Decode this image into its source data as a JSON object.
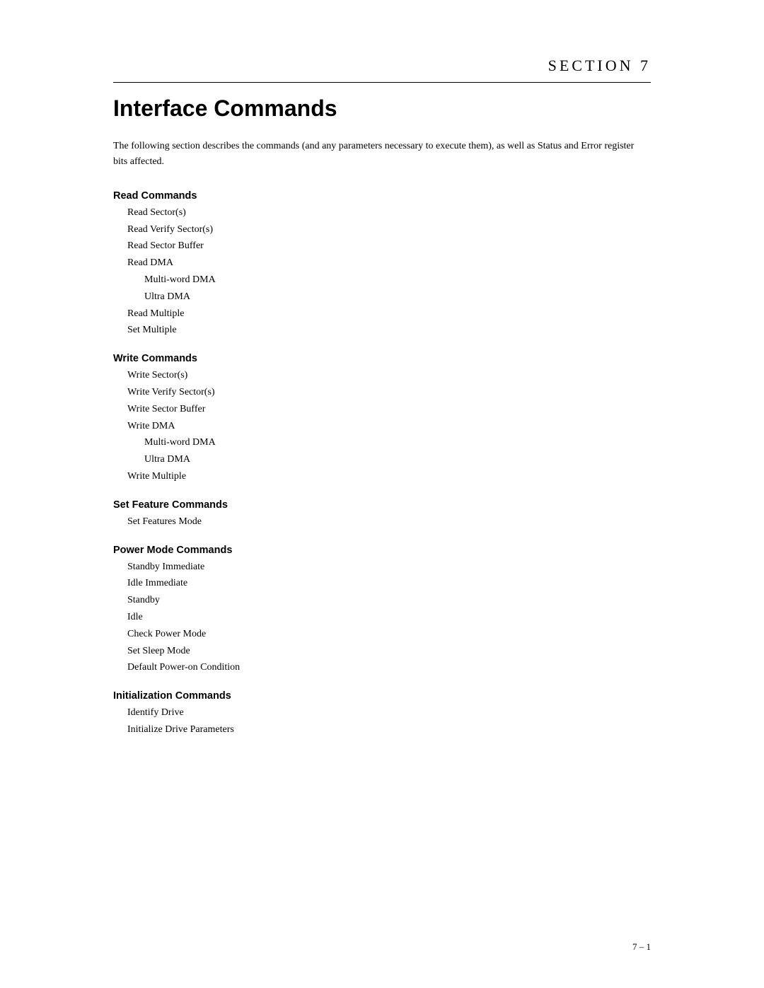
{
  "page": {
    "section_label": "SECTION 7",
    "title": "Interface Commands",
    "intro": "The following section describes the commands (and any parameters necessary to execute them), as well as Status and Error register bits affected.",
    "page_number": "7 – 1"
  },
  "groups": [
    {
      "id": "read-commands",
      "heading": "Read Commands",
      "items": [
        {
          "text": "Read Sector(s)",
          "indent": false
        },
        {
          "text": "Read Verify Sector(s)",
          "indent": false
        },
        {
          "text": "Read Sector Buffer",
          "indent": false
        },
        {
          "text": "Read DMA",
          "indent": false
        },
        {
          "text": "Multi-word DMA",
          "indent": true
        },
        {
          "text": "Ultra DMA",
          "indent": true
        },
        {
          "text": "Read Multiple",
          "indent": false
        },
        {
          "text": "Set Multiple",
          "indent": false
        }
      ]
    },
    {
      "id": "write-commands",
      "heading": "Write Commands",
      "items": [
        {
          "text": "Write Sector(s)",
          "indent": false
        },
        {
          "text": "Write Verify Sector(s)",
          "indent": false
        },
        {
          "text": "Write Sector Buffer",
          "indent": false
        },
        {
          "text": "Write DMA",
          "indent": false
        },
        {
          "text": "Multi-word DMA",
          "indent": true
        },
        {
          "text": "Ultra DMA",
          "indent": true
        },
        {
          "text": "Write Multiple",
          "indent": false
        }
      ]
    },
    {
      "id": "set-feature-commands",
      "heading": "Set Feature Commands",
      "items": [
        {
          "text": "Set Features Mode",
          "indent": false
        }
      ]
    },
    {
      "id": "power-mode-commands",
      "heading": "Power Mode Commands",
      "items": [
        {
          "text": "Standby Immediate",
          "indent": false
        },
        {
          "text": "Idle Immediate",
          "indent": false
        },
        {
          "text": "Standby",
          "indent": false
        },
        {
          "text": "Idle",
          "indent": false
        },
        {
          "text": "Check Power Mode",
          "indent": false
        },
        {
          "text": "Set Sleep Mode",
          "indent": false
        },
        {
          "text": "Default Power-on Condition",
          "indent": false
        }
      ]
    },
    {
      "id": "initialization-commands",
      "heading": "Initialization Commands",
      "items": [
        {
          "text": "Identify Drive",
          "indent": false
        },
        {
          "text": "Initialize Drive Parameters",
          "indent": false
        }
      ]
    }
  ]
}
